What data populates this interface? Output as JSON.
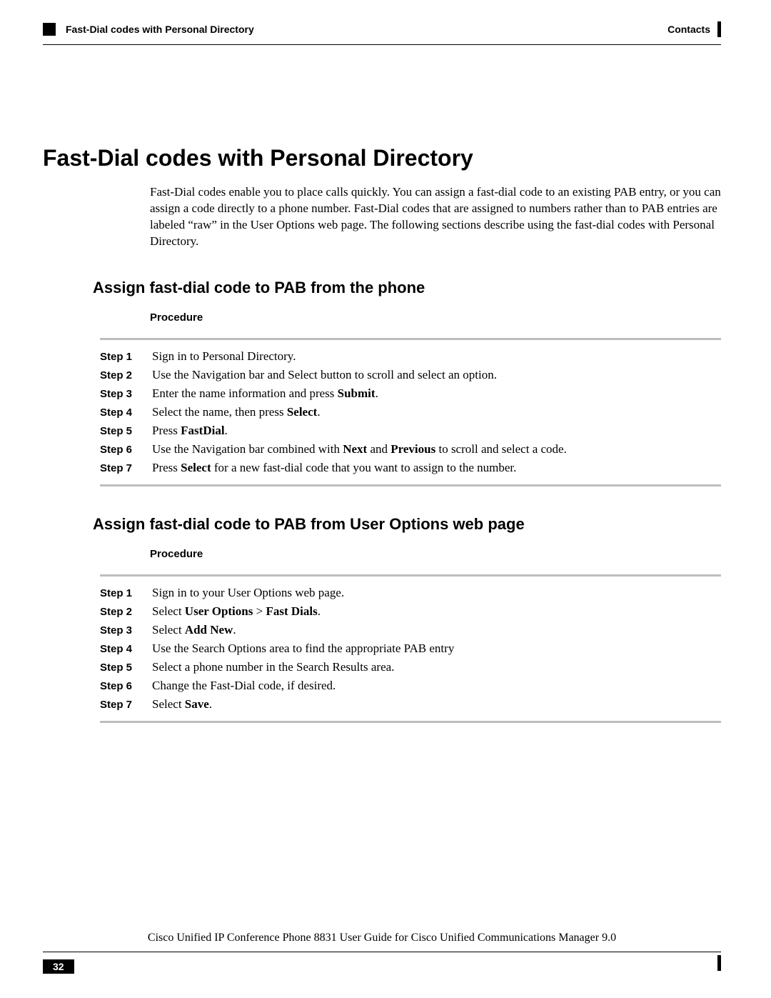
{
  "header": {
    "running_title": "Fast-Dial codes with Personal Directory",
    "section": "Contacts"
  },
  "main": {
    "heading": "Fast-Dial codes with Personal Directory",
    "intro": "Fast-Dial codes enable you to place calls quickly. You can assign a fast-dial code to an existing PAB entry, or you can assign a code directly to a phone number. Fast-Dial codes that are assigned to numbers rather than to PAB entries are labeled “raw” in the User Options web page. The following sections describe using the fast-dial codes with Personal Directory."
  },
  "section1": {
    "heading": "Assign fast-dial code to PAB from the phone",
    "procedure_label": "Procedure",
    "steps": [
      {
        "label": "Step 1",
        "html": "Sign in to Personal Directory."
      },
      {
        "label": "Step 2",
        "html": "Use the Navigation bar and Select button to scroll and select an option."
      },
      {
        "label": "Step 3",
        "html": "Enter the name information and press <b>Submit</b>."
      },
      {
        "label": "Step 4",
        "html": "Select the name, then press <b>Select</b>."
      },
      {
        "label": "Step 5",
        "html": "Press <b>FastDial</b>."
      },
      {
        "label": "Step 6",
        "html": "Use the Navigation bar combined with <b>Next</b> and <b>Previous</b> to scroll and select a code."
      },
      {
        "label": "Step 7",
        "html": "Press <b>Select</b> for a new fast-dial code that you want to assign to the number."
      }
    ]
  },
  "section2": {
    "heading": "Assign fast-dial code to PAB from User Options web page",
    "procedure_label": "Procedure",
    "steps": [
      {
        "label": "Step 1",
        "html": "Sign in to your User Options web page."
      },
      {
        "label": "Step 2",
        "html": "Select <b>User Options</b> > <b>Fast Dials</b>."
      },
      {
        "label": "Step 3",
        "html": "Select <b>Add New</b>."
      },
      {
        "label": "Step 4",
        "html": "Use the Search Options area to find the appropriate PAB entry"
      },
      {
        "label": "Step 5",
        "html": "Select a phone number in the Search Results area."
      },
      {
        "label": "Step 6",
        "html": "Change the Fast-Dial code, if desired."
      },
      {
        "label": "Step 7",
        "html": "Select <b>Save</b>."
      }
    ]
  },
  "footer": {
    "doc_title": "Cisco Unified IP Conference Phone 8831 User Guide for Cisco Unified Communications Manager 9.0",
    "page_number": "32"
  }
}
